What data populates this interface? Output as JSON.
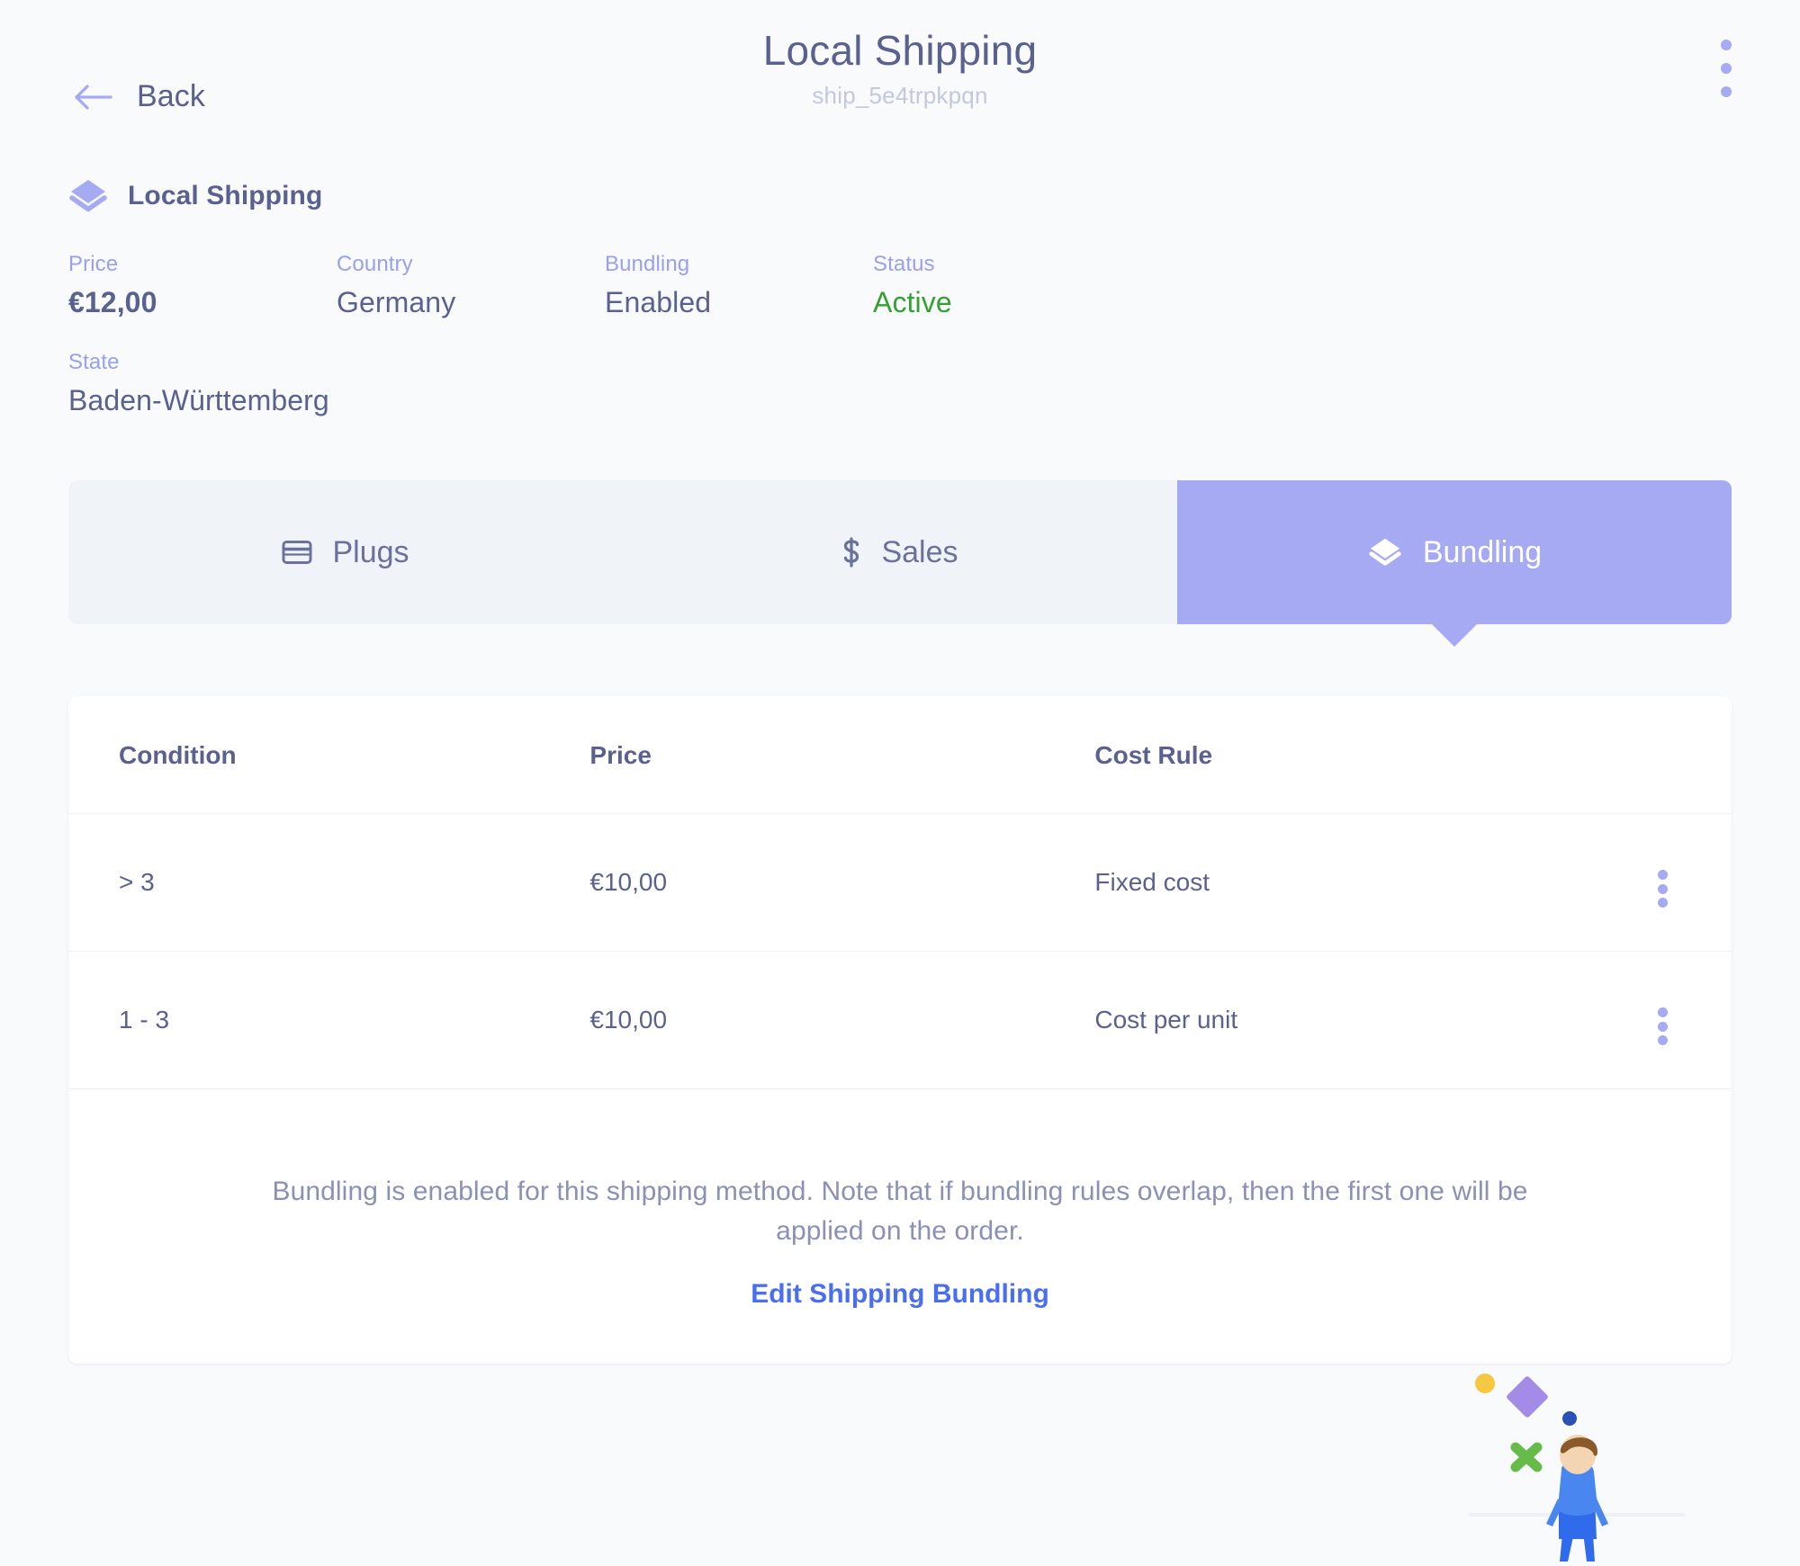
{
  "header": {
    "back_label": "Back",
    "title": "Local Shipping",
    "subtitle": "ship_5e4trpkpqn",
    "overflow_menu": "more-options"
  },
  "summary": {
    "icon": "layers-icon",
    "title": "Local Shipping",
    "fields": [
      {
        "label": "Price",
        "value": "€12,00"
      },
      {
        "label": "Country",
        "value": "Germany"
      },
      {
        "label": "Bundling",
        "value": "Enabled"
      },
      {
        "label": "Status",
        "value": "Active"
      },
      {
        "label": "State",
        "value": "Baden-Württemberg"
      }
    ]
  },
  "tabs": [
    {
      "label": "Plugs",
      "icon": "credit-card-icon",
      "active": false
    },
    {
      "label": "Sales",
      "icon": "dollar-icon",
      "active": false
    },
    {
      "label": "Bundling",
      "icon": "layers-icon",
      "active": true
    }
  ],
  "table": {
    "columns": [
      "Condition",
      "Price",
      "Cost Rule"
    ],
    "rows": [
      {
        "condition": "> 3",
        "price": "€10,00",
        "cost_rule": "Fixed cost"
      },
      {
        "condition": "1 - 3",
        "price": "€10,00",
        "cost_rule": "Cost per unit"
      }
    ]
  },
  "footer": {
    "note": "Bundling is enabled for this shipping method. Note that if bundling rules overlap, then the first one will be applied on the order.",
    "link": "Edit Shipping Bundling"
  },
  "colors": {
    "accent": "#a5aaf2",
    "text": "#5b618f",
    "label": "#9aa0ea",
    "active_status": "#35a135",
    "link": "#4a6ef0",
    "page_bg": "#f8fafc",
    "tab_bg": "#f0f4f9"
  }
}
